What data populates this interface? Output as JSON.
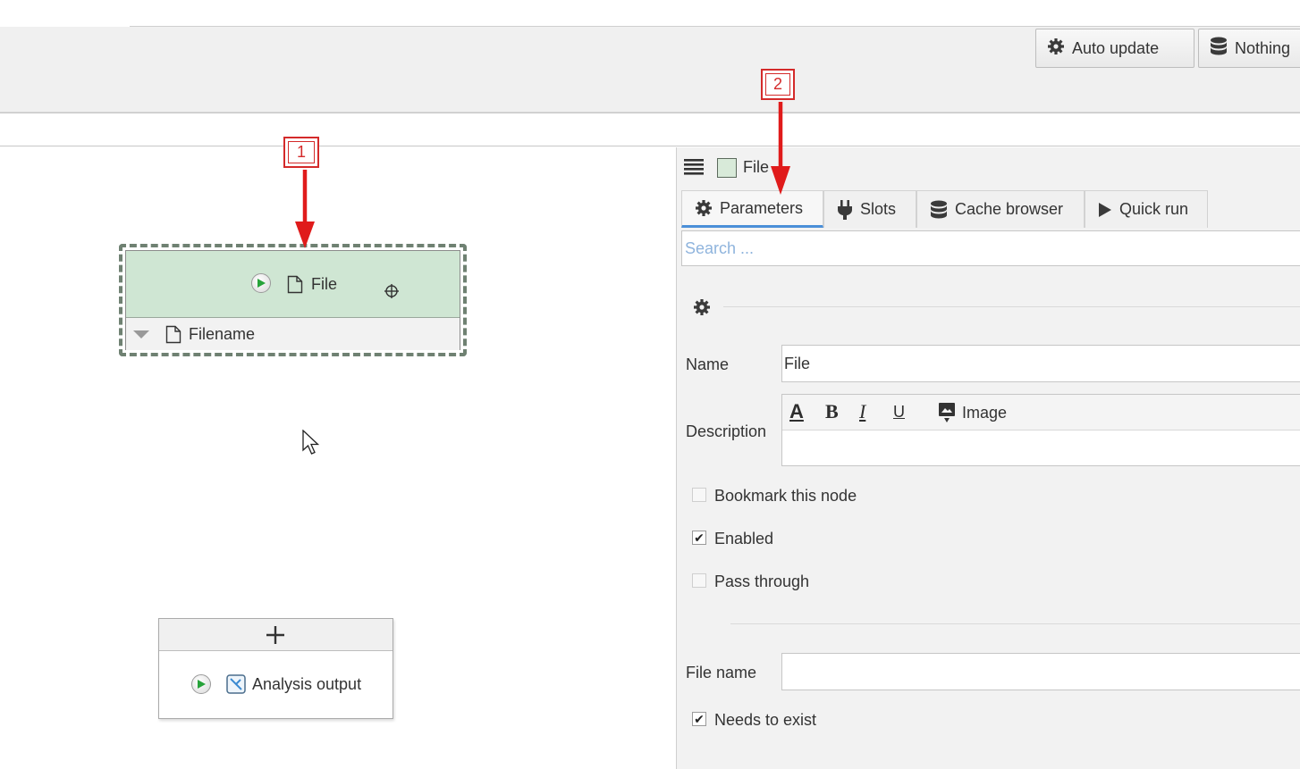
{
  "toolbar": {
    "auto_update_label": "Auto update",
    "nothing_label": "Nothing"
  },
  "graph": {
    "file_node": {
      "title": "File",
      "slot_label": "Filename"
    },
    "output_node": {
      "title": "Analysis output"
    },
    "annotations": {
      "callout_1": "1",
      "callout_2": "2"
    }
  },
  "panel": {
    "header_title": "File",
    "tabs": [
      {
        "label": "Parameters",
        "icon": "gear-icon"
      },
      {
        "label": "Slots",
        "icon": "plug-icon"
      },
      {
        "label": "Cache browser",
        "icon": "database-icon"
      },
      {
        "label": "Quick run",
        "icon": "play-icon"
      }
    ],
    "search_placeholder": "Search ...",
    "name_label": "Name",
    "name_value": "File",
    "description_label": "Description",
    "image_label": "Image",
    "bookmark_label": "Bookmark this node",
    "bookmark_checked": false,
    "enabled_label": "Enabled",
    "enabled_checked": true,
    "pass_through_label": "Pass through",
    "pass_through_checked": false,
    "file_name_label": "File name",
    "file_name_value": "",
    "needs_exist_label": "Needs to exist",
    "needs_exist_checked": true
  },
  "colors": {
    "node_header": "#cfe6d3",
    "selection_border": "#6f8172",
    "annotation_red": "#d42a2a",
    "active_tab_accent": "#4b8fd8",
    "run_green": "#27a33a"
  }
}
